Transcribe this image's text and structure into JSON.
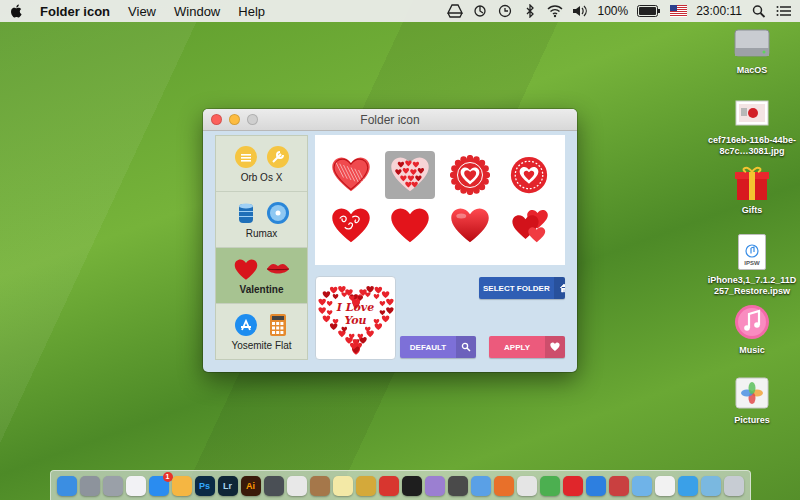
{
  "menubar": {
    "app": "Folder icon",
    "menus": [
      "View",
      "Window",
      "Help"
    ],
    "battery": {
      "reading": "100%",
      "level": 1
    },
    "clock": "23:00:11"
  },
  "window": {
    "title": "Folder icon"
  },
  "sidebar": {
    "items": [
      {
        "label": "Orb Os X",
        "kind": "orb",
        "selected": false
      },
      {
        "label": "Rumax",
        "kind": "rumax",
        "selected": false
      },
      {
        "label": "Valentine",
        "kind": "valentine",
        "selected": true
      },
      {
        "label": "Yosemite Flat",
        "kind": "yosemite",
        "selected": false
      }
    ]
  },
  "icon_grid": {
    "items": [
      {
        "kind": "scribble",
        "selected": false
      },
      {
        "kind": "heart-cluster",
        "selected": true
      },
      {
        "kind": "badge",
        "selected": false
      },
      {
        "kind": "ring",
        "selected": false
      },
      {
        "kind": "swirl",
        "selected": false
      },
      {
        "kind": "plain",
        "selected": false
      },
      {
        "kind": "glossy",
        "selected": false
      },
      {
        "kind": "cluster",
        "selected": false
      }
    ]
  },
  "preview": {
    "text": "I Love You"
  },
  "buttons": [
    {
      "label": "SELECT FOLDER",
      "kind": "home",
      "color": "#2f5eb4"
    },
    {
      "label": "DEFAULT",
      "kind": "search",
      "color": "#7d70d8"
    },
    {
      "label": "APPLY",
      "kind": "heart",
      "color": "#ec5a7c"
    }
  ],
  "desktop": {
    "items": [
      {
        "label": "MacOS",
        "kind": "drive",
        "tag": ""
      },
      {
        "label": "cef716eb-116b-44be-8c7c…3081.jpg",
        "kind": "image",
        "tag": ""
      },
      {
        "label": "Gifts",
        "kind": "gift",
        "tag": ""
      },
      {
        "label": "iPhone3,1_7.1.2_11D257_Restore.ipsw",
        "kind": "document",
        "tag": "IPSW"
      },
      {
        "label": "Music",
        "kind": "music",
        "tag": ""
      },
      {
        "label": "Pictures",
        "kind": "pictures",
        "tag": ""
      }
    ]
  },
  "dock": {
    "items": [
      {
        "color": "#3b8ee2",
        "label": "",
        "label_color": "",
        "badge": ""
      },
      {
        "color": "#8d939c",
        "label": "",
        "label_color": "",
        "badge": ""
      },
      {
        "color": "#9aa0a8",
        "label": "",
        "label_color": "",
        "badge": ""
      },
      {
        "color": "#f2f2f5",
        "label": "",
        "label_color": "",
        "badge": ""
      },
      {
        "color": "#2a8cf0",
        "label": "",
        "label_color": "",
        "badge": "1"
      },
      {
        "color": "#f5b642",
        "label": "",
        "label_color": "",
        "badge": ""
      },
      {
        "color": "#0b2a45",
        "label": "Ps",
        "label_color": "#31a8ff",
        "badge": ""
      },
      {
        "color": "#0f2536",
        "label": "Lr",
        "label_color": "#a9d6f0",
        "badge": ""
      },
      {
        "color": "#3a1a0a",
        "label": "Ai",
        "label_color": "#ff9a00",
        "badge": ""
      },
      {
        "color": "#4a4f55",
        "label": "",
        "label_color": "",
        "badge": ""
      },
      {
        "color": "#e8e8e8",
        "label": "",
        "label_color": "",
        "badge": ""
      },
      {
        "color": "#a5774a",
        "label": "",
        "label_color": "",
        "badge": ""
      },
      {
        "color": "#f3e9a6",
        "label": "",
        "label_color": "",
        "badge": ""
      },
      {
        "color": "#d4a93a",
        "label": "",
        "label_color": "",
        "badge": ""
      },
      {
        "color": "#d8362f",
        "label": "",
        "label_color": "",
        "badge": ""
      },
      {
        "color": "#1e1e1e",
        "label": "",
        "label_color": "",
        "badge": ""
      },
      {
        "color": "#9b7fd1",
        "label": "",
        "label_color": "",
        "badge": ""
      },
      {
        "color": "#4a4a4a",
        "label": "",
        "label_color": "",
        "badge": ""
      },
      {
        "color": "#5aa0e6",
        "label": "",
        "label_color": "",
        "badge": ""
      },
      {
        "color": "#e8702a",
        "label": "",
        "label_color": "",
        "badge": ""
      },
      {
        "color": "#e5e5e5",
        "label": "",
        "label_color": "",
        "badge": ""
      },
      {
        "color": "#4caf50",
        "label": "",
        "label_color": "",
        "badge": ""
      },
      {
        "color": "#e0262b",
        "label": "",
        "label_color": "",
        "badge": ""
      },
      {
        "color": "#2d7fe0",
        "label": "",
        "label_color": "",
        "badge": ""
      },
      {
        "color": "#c94040",
        "label": "",
        "label_color": "",
        "badge": ""
      },
      {
        "color": "#6fb3e8",
        "label": "",
        "label_color": "",
        "badge": ""
      },
      {
        "color": "#f2f2f2",
        "label": "",
        "label_color": "",
        "badge": ""
      },
      {
        "color": "#3aa0e8",
        "label": "",
        "label_color": "",
        "badge": ""
      },
      {
        "color": "#7ab8e0",
        "label": "",
        "label_color": "",
        "badge": ""
      },
      {
        "color": "#c7ccd3",
        "label": "",
        "label_color": "",
        "badge": ""
      }
    ]
  }
}
